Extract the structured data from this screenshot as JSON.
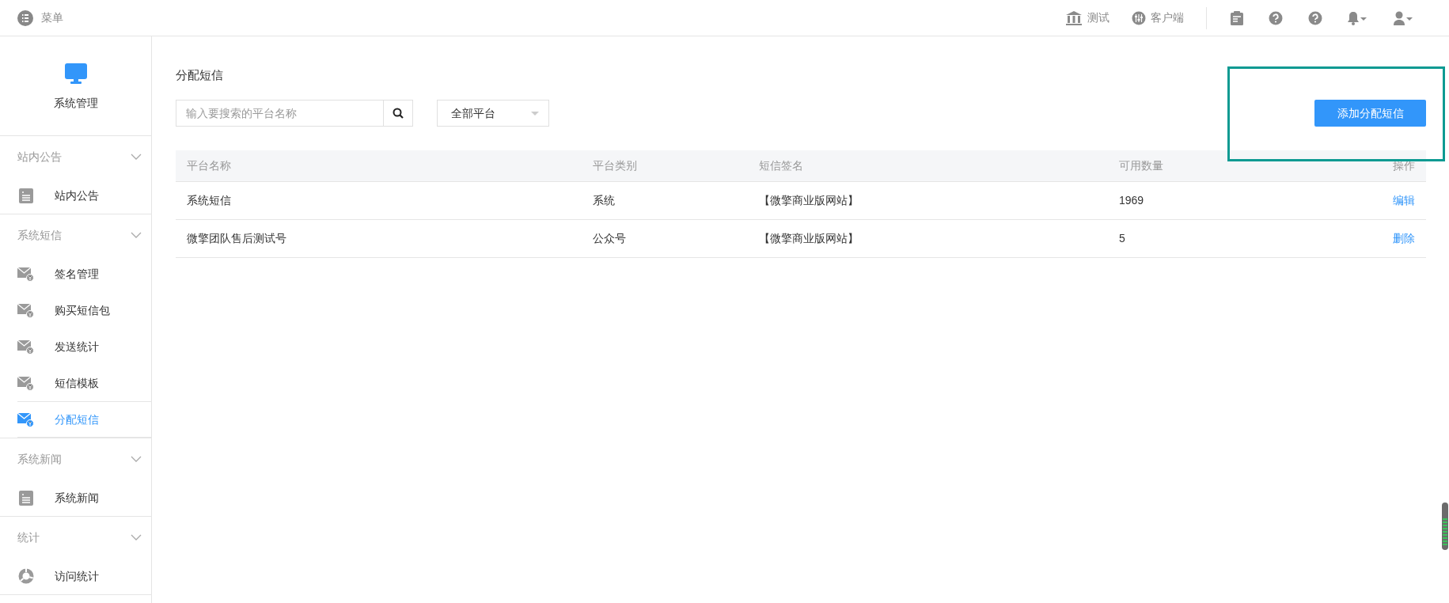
{
  "topbar": {
    "menu_label": "菜单",
    "links": [
      {
        "kind": "bank",
        "label": "测试"
      },
      {
        "kind": "sliders",
        "label": "客户端"
      }
    ],
    "icons": [
      {
        "kind": "clipboard"
      },
      {
        "kind": "help"
      },
      {
        "kind": "help"
      },
      {
        "kind": "bell"
      },
      {
        "kind": "user"
      }
    ]
  },
  "sidebar": {
    "title": "系统管理",
    "groups": [
      {
        "label": "站内公告",
        "items": [
          {
            "kind": "document",
            "label": "站内公告",
            "selected": false
          }
        ]
      },
      {
        "label": "系统短信",
        "items": [
          {
            "kind": "mail",
            "label": "签名管理",
            "selected": false
          },
          {
            "kind": "mail",
            "label": "购买短信包",
            "selected": false
          },
          {
            "kind": "mail",
            "label": "发送统计",
            "selected": false
          },
          {
            "kind": "mail",
            "label": "短信模板",
            "selected": false
          },
          {
            "kind": "mail",
            "label": "分配短信",
            "selected": true
          }
        ]
      },
      {
        "label": "系统新闻",
        "items": [
          {
            "kind": "document",
            "label": "系统新闻",
            "selected": false
          }
        ]
      },
      {
        "label": "统计",
        "items": [
          {
            "kind": "chart",
            "label": "访问统计",
            "selected": false
          }
        ]
      }
    ]
  },
  "content": {
    "title": "分配短信",
    "search": {
      "placeholder": "输入要搜索的平台名称"
    },
    "platform_filter": "全部平台",
    "add_button": "添加分配短信",
    "table": {
      "columns": [
        "平台名称",
        "平台类别",
        "短信签名",
        "可用数量",
        "操作"
      ],
      "rows": [
        {
          "cells": [
            "系统短信",
            "系统",
            "【微擎商业版网站】",
            "1969"
          ],
          "action": "编辑"
        },
        {
          "cells": [
            "微擎团队售后测试号",
            "公众号",
            "【微擎商业版网站】",
            "5"
          ],
          "action": "删除"
        }
      ]
    }
  }
}
